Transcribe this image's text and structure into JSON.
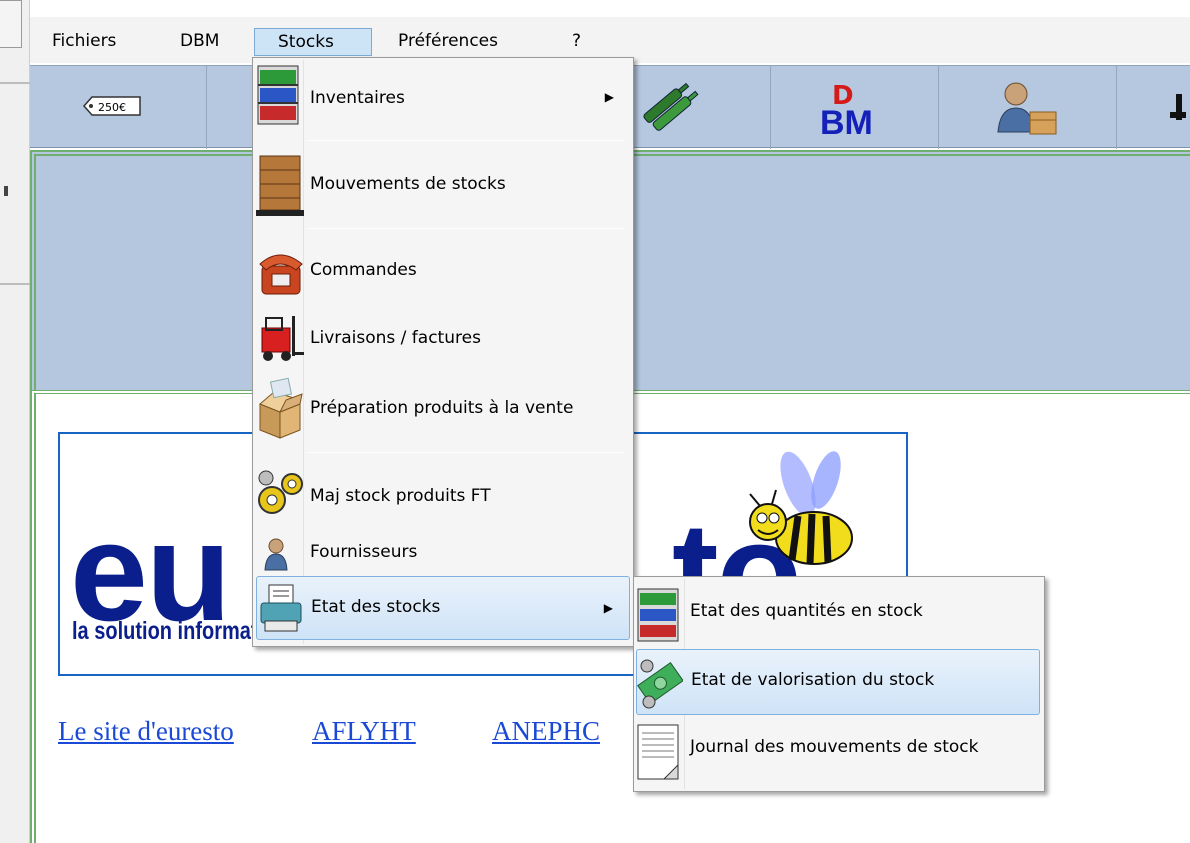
{
  "menubar": {
    "items": [
      {
        "label": "Fichiers"
      },
      {
        "label": "DBM"
      },
      {
        "label": "Stocks"
      },
      {
        "label": "Préférences"
      },
      {
        "label": "?"
      }
    ]
  },
  "toolbar": {
    "price_tag_text": "250€",
    "dbm_logo_text": "BM",
    "dbm_logo_letter": "D"
  },
  "stocks_menu": {
    "items": [
      {
        "label": "Inventaires",
        "icon": "shelf-icon",
        "has_submenu": true
      },
      {
        "label": "Mouvements de stocks",
        "icon": "crate-icon"
      },
      {
        "label": "Commandes",
        "icon": "phone-icon"
      },
      {
        "label": "Livraisons / factures",
        "icon": "forklift-icon"
      },
      {
        "label": "Préparation produits à la vente",
        "icon": "open-box-icon"
      },
      {
        "label": "Maj stock produits FT",
        "icon": "gears-icon"
      },
      {
        "label": "Fournisseurs",
        "icon": "person-icon"
      },
      {
        "label": "Etat des stocks",
        "icon": "printer-icon",
        "has_submenu": true,
        "highlighted": true
      }
    ]
  },
  "etat_submenu": {
    "items": [
      {
        "label": "Etat des quantités en stock",
        "icon": "shelf-icon"
      },
      {
        "label": "Etat de valorisation du stock",
        "icon": "money-gears-icon",
        "highlighted": true
      },
      {
        "label": "Journal des mouvements de stock",
        "icon": "document-icon"
      }
    ]
  },
  "logo": {
    "brand_text": "eu",
    "brand_text_2": "to",
    "tagline": "la solution informatique des restaurants R"
  },
  "links": [
    {
      "label": "Le site d'euresto"
    },
    {
      "label": "AFLYHT"
    },
    {
      "label": "ANEPHC"
    }
  ],
  "colors": {
    "toolbar_bg": "#b5c8df",
    "menu_highlight": "#cfe3f7",
    "logo_blue": "#0b1f8c",
    "link_blue": "#1a49d6",
    "frame_green": "#6fae6f"
  }
}
